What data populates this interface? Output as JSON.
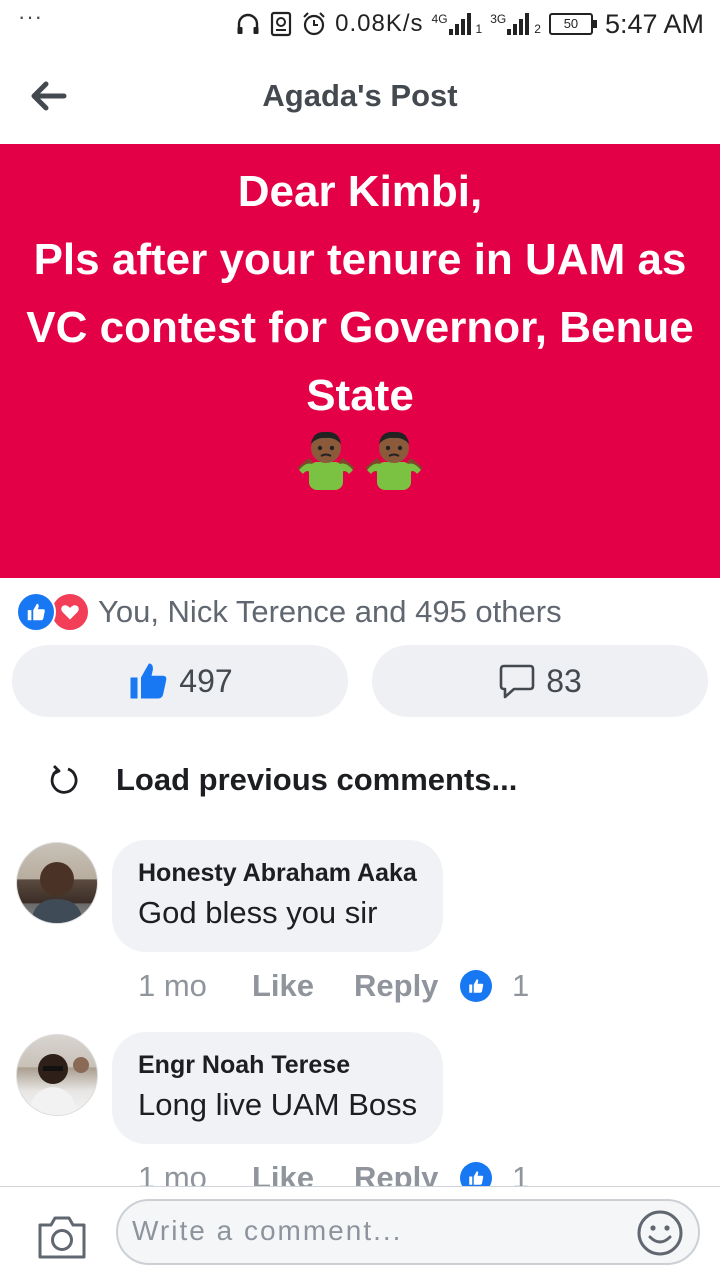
{
  "status_bar": {
    "menu_dots": "···",
    "net_speed": "0.08K/s",
    "sim1_type": "4G",
    "sim1_slot": "1",
    "sim2_type": "3G",
    "sim2_slot": "2",
    "battery": "50",
    "time": "5:47 AM"
  },
  "header": {
    "title": "Agada's Post"
  },
  "post": {
    "text": "Dear Kimbi,\nPls after your tenure in UAM as VC contest for Governor, Benue State",
    "emoji": "🤷🏾‍♂️🤷🏾‍♂️",
    "background_color": "#e40046",
    "reactions_summary": "You, Nick Terence and 495 others",
    "like_count": "497",
    "comment_count": "83"
  },
  "load_previous": "Load previous comments...",
  "comments": [
    {
      "name": "Honesty Abraham Aaka",
      "text": "God bless you sir",
      "age": "1 mo",
      "like_label": "Like",
      "reply_label": "Reply",
      "likes": "1"
    },
    {
      "name": "Engr Noah Terese",
      "text": "Long live UAM Boss",
      "age": "1 mo",
      "like_label": "Like",
      "reply_label": "Reply",
      "likes": "1"
    }
  ],
  "composer": {
    "placeholder": "Write a comment..."
  },
  "colors": {
    "brand_blue": "#1877f2",
    "love_red": "#f33e58"
  }
}
